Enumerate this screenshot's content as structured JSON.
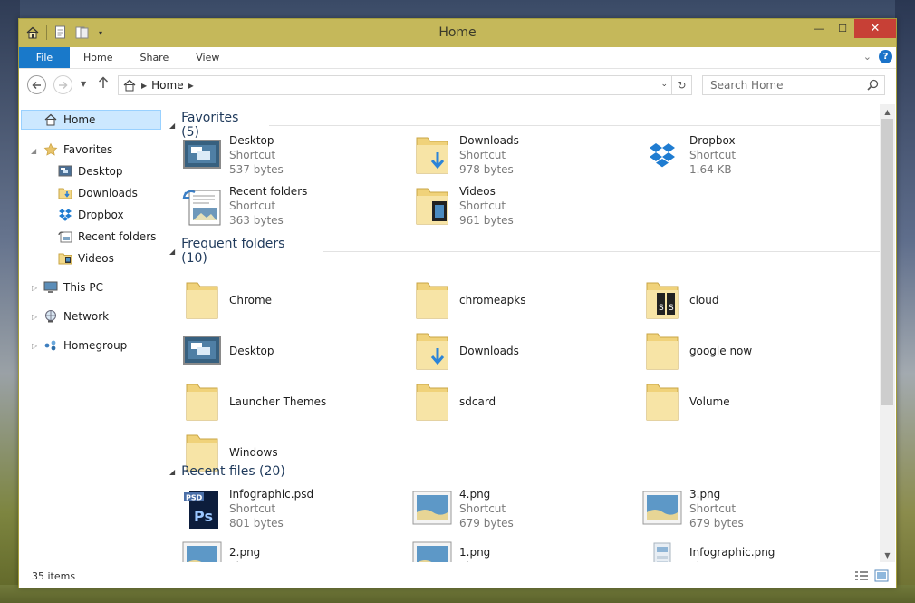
{
  "window": {
    "title": "Home",
    "accent": "#c5b85a",
    "close_color": "#c74036",
    "controls": {
      "minimize": "—",
      "maximize": "☐",
      "close": "✕"
    }
  },
  "ribbon": {
    "tabs": [
      "File",
      "Home",
      "Share",
      "View"
    ],
    "file_color": "#1979ca"
  },
  "address": {
    "crumbs": [
      "Home"
    ],
    "search_placeholder": "Search Home"
  },
  "nav": {
    "home": "Home",
    "favorites": "Favorites",
    "favorites_items": [
      "Desktop",
      "Downloads",
      "Dropbox",
      "Recent folders",
      "Videos"
    ],
    "this_pc": "This PC",
    "network": "Network",
    "homegroup": "Homegroup"
  },
  "groups": {
    "favorites": {
      "label": "Favorites (5)",
      "items": [
        {
          "name": "Desktop",
          "type": "Shortcut",
          "size": "537 bytes",
          "icon": "desktop-icon"
        },
        {
          "name": "Downloads",
          "type": "Shortcut",
          "size": "978 bytes",
          "icon": "downloads-folder-icon"
        },
        {
          "name": "Dropbox",
          "type": "Shortcut",
          "size": "1.64 KB",
          "icon": "dropbox-icon"
        },
        {
          "name": "Recent folders",
          "type": "Shortcut",
          "size": "363 bytes",
          "icon": "recent-folders-icon"
        },
        {
          "name": "Videos",
          "type": "Shortcut",
          "size": "961 bytes",
          "icon": "videos-folder-icon"
        }
      ]
    },
    "frequent": {
      "label": "Frequent folders (10)",
      "items": [
        {
          "name": "Chrome",
          "icon": "folder-icon"
        },
        {
          "name": "chromeapks",
          "icon": "folder-icon"
        },
        {
          "name": "cloud",
          "icon": "cloud-folder-icon"
        },
        {
          "name": "Desktop",
          "icon": "desktop-icon"
        },
        {
          "name": "Downloads",
          "icon": "downloads-folder-icon"
        },
        {
          "name": "google now",
          "icon": "folder-icon"
        },
        {
          "name": "Launcher Themes",
          "icon": "folder-icon"
        },
        {
          "name": "sdcard",
          "icon": "folder-icon"
        },
        {
          "name": "Volume",
          "icon": "folder-icon"
        },
        {
          "name": "Windows",
          "icon": "folder-icon"
        }
      ]
    },
    "recent": {
      "label": "Recent files (20)",
      "items": [
        {
          "name": "Infographic.psd",
          "type": "Shortcut",
          "size": "801 bytes",
          "icon": "psd-file-icon"
        },
        {
          "name": "4.png",
          "type": "Shortcut",
          "size": "679 bytes",
          "icon": "image-file-icon"
        },
        {
          "name": "3.png",
          "type": "Shortcut",
          "size": "679 bytes",
          "icon": "image-file-icon"
        },
        {
          "name": "2.png",
          "type": "Shortcut",
          "size": "",
          "icon": "image-file-icon"
        },
        {
          "name": "1.png",
          "type": "Shortcut",
          "size": "",
          "icon": "image-file-icon"
        },
        {
          "name": "Infographic.png",
          "type": "Shortcut",
          "size": "",
          "icon": "png-file-icon"
        }
      ]
    }
  },
  "status": {
    "count": "35 items"
  }
}
